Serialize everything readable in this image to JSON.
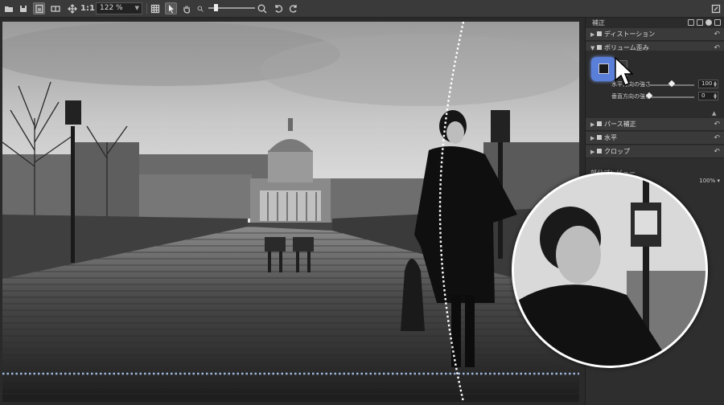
{
  "toolbar": {
    "zoom_value": "122 %",
    "actual_size_label": "1:1",
    "icons": [
      "folder-icon",
      "save-icon",
      "info-icon",
      "compare-icon",
      "move-icon",
      "actual-size",
      "zoom-field",
      "grid-icon",
      "pointer-icon",
      "hand-icon",
      "zoom-out-icon",
      "zoom-in-icon",
      "rotate-left-icon",
      "rotate-right-icon",
      "fullscreen-icon"
    ]
  },
  "panel": {
    "title": "補正",
    "sections": [
      {
        "label": "ディストーション",
        "checked": true,
        "expanded": false
      },
      {
        "label": "ボリューム歪み",
        "checked": true,
        "expanded": true
      },
      {
        "label": "パース補正",
        "checked": true,
        "expanded": false
      },
      {
        "label": "水平",
        "checked": true,
        "expanded": false
      },
      {
        "label": "クロップ",
        "checked": true,
        "expanded": false
      }
    ],
    "volume": {
      "horizontal_label": "水平方向の強さ",
      "horizontal_value": "100",
      "vertical_label": "垂直方向の強さ",
      "vertical_value": "0"
    },
    "preview": {
      "title": "部分プレビュー",
      "zoom": "100%"
    }
  },
  "colors": {
    "accent": "#5a7fd8",
    "panel_bg": "#2e2e2e",
    "toolbar_bg": "#3a3a3a"
  }
}
